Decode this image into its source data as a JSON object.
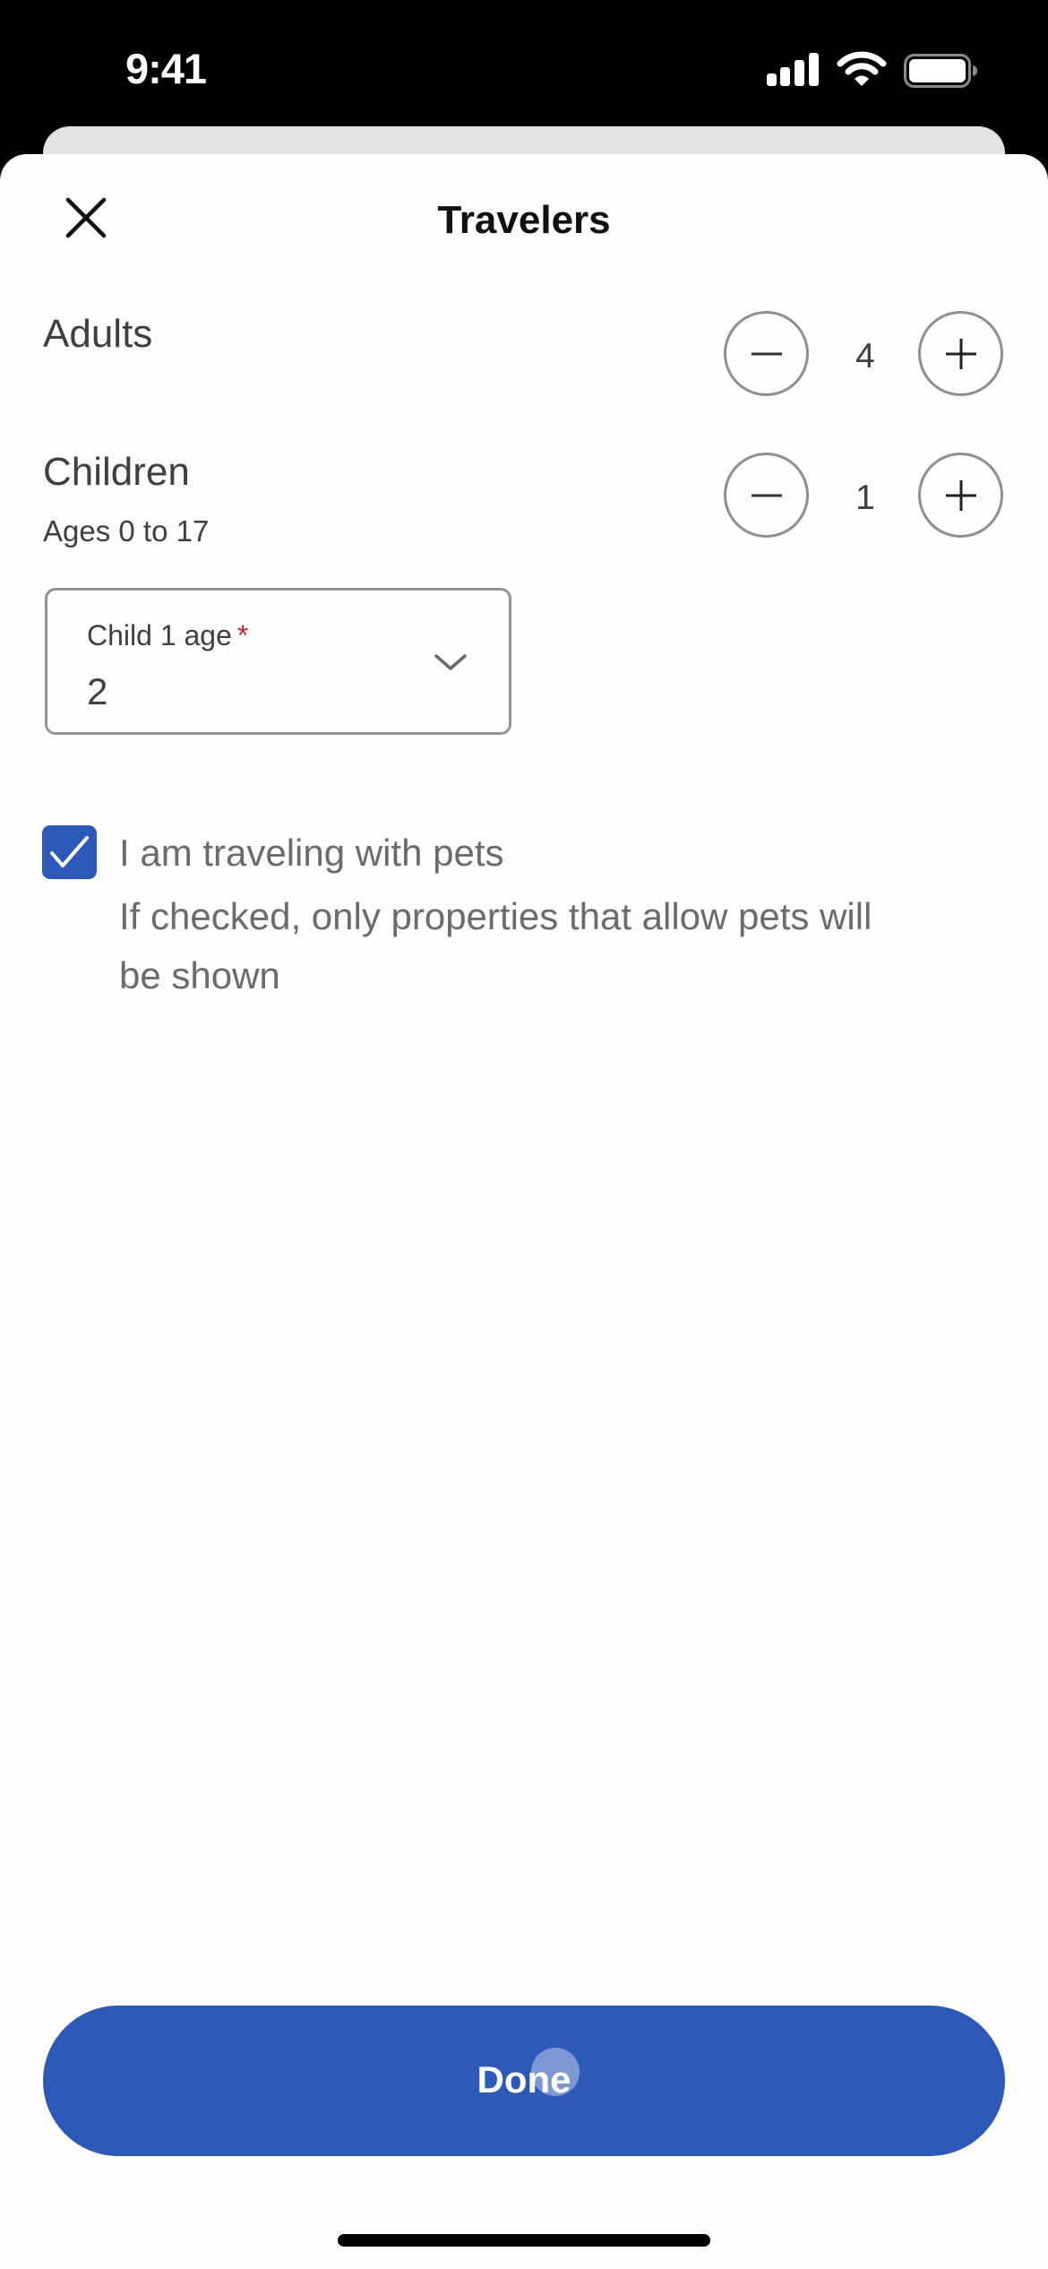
{
  "status_bar": {
    "time": "9:41",
    "icons": [
      "cellular-signal-icon",
      "wifi-icon",
      "battery-icon"
    ]
  },
  "header": {
    "title": "Travelers",
    "close_icon": "close-icon"
  },
  "adults": {
    "label": "Adults",
    "count": "4",
    "decrement_icon": "minus-icon",
    "increment_icon": "plus-icon"
  },
  "children": {
    "label": "Children",
    "sublabel": "Ages 0 to 17",
    "count": "1",
    "decrement_icon": "minus-icon",
    "increment_icon": "plus-icon"
  },
  "child_ages": [
    {
      "label": "Child 1 age",
      "required_marker": "*",
      "value": "2",
      "icon": "chevron-down-icon"
    }
  ],
  "pets": {
    "checked": true,
    "label": "I am traveling with pets",
    "help_line1": "If checked, only properties that allow pets will",
    "help_line2": "be shown"
  },
  "footer": {
    "done_label": "Done"
  },
  "colors": {
    "accent": "#2c58b7",
    "required": "#c0283a",
    "text_primary": "#3f3f3f",
    "text_secondary": "#6b6b6b"
  }
}
